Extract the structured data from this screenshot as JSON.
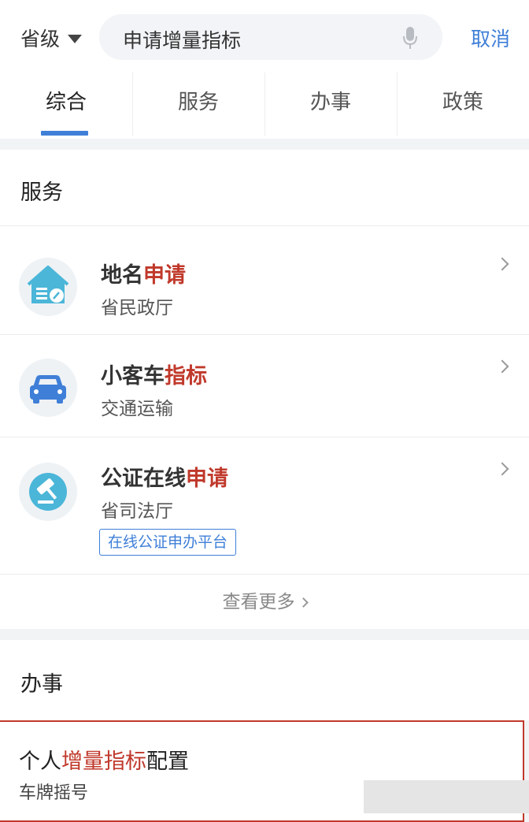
{
  "header": {
    "level_label": "省级",
    "search_query": "申请增量指标",
    "cancel_label": "取消"
  },
  "tabs": [
    {
      "label": "综合",
      "active": true
    },
    {
      "label": "服务",
      "active": false
    },
    {
      "label": "办事",
      "active": false
    },
    {
      "label": "政策",
      "active": false
    }
  ],
  "services": {
    "title": "服务",
    "items": [
      {
        "title_plain": "地名",
        "title_highlight": "申请",
        "subtitle": "省民政厅",
        "icon": "house-edit-icon"
      },
      {
        "title_plain": "小客车",
        "title_highlight": "指标",
        "subtitle": "交通运输",
        "icon": "car-icon"
      },
      {
        "title_plain": "公证在线",
        "title_highlight": "申请",
        "subtitle": "省司法厅",
        "tag": "在线公证申办平台",
        "icon": "gavel-icon"
      }
    ],
    "more_label": "查看更多"
  },
  "affairs": {
    "title": "办事",
    "item": {
      "title_prefix": "个人",
      "title_highlight": "增量指标",
      "title_suffix": "配置",
      "subtitle": "车牌摇号"
    }
  },
  "colors": {
    "accent": "#3f7fd8",
    "highlight": "#c0392b",
    "icon_teal": "#4bb6d8"
  }
}
